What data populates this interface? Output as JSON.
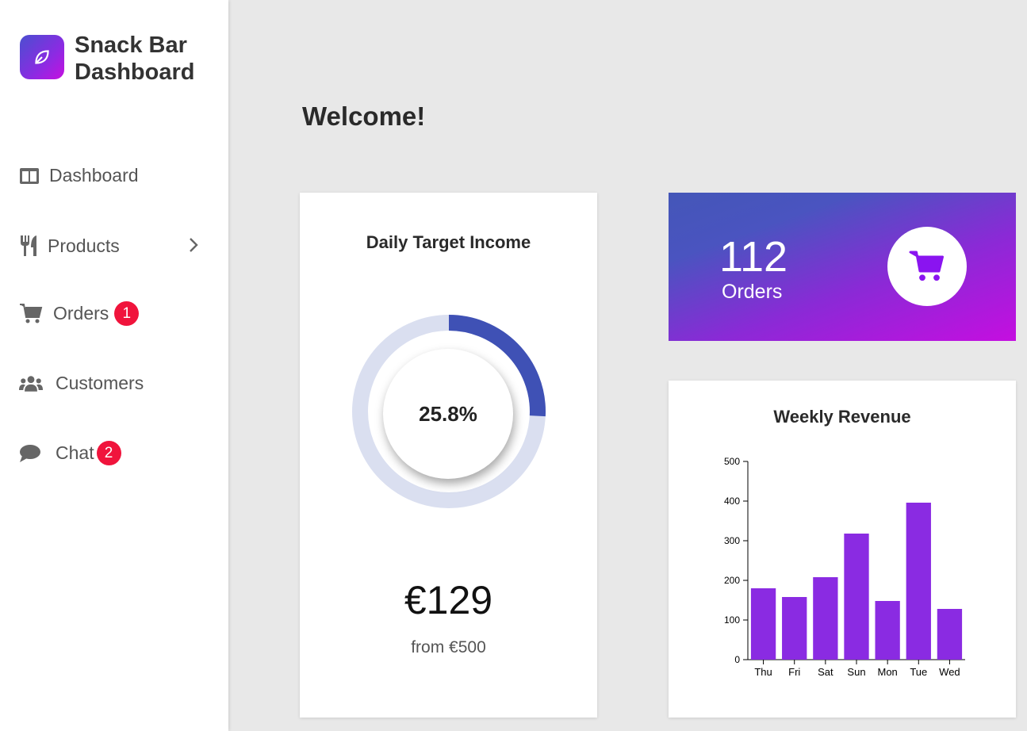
{
  "brand": {
    "line1": "Snack Bar",
    "line2": "Dashboard",
    "logo_icon": "leaf-icon"
  },
  "nav": {
    "dashboard": {
      "label": "Dashboard",
      "icon": "dashboard-icon"
    },
    "products": {
      "label": "Products",
      "icon": "utensils-icon"
    },
    "orders": {
      "label": "Orders",
      "icon": "cart-icon",
      "badge": "1"
    },
    "customers": {
      "label": "Customers",
      "icon": "users-icon"
    },
    "chat": {
      "label": "Chat",
      "icon": "chat-icon",
      "badge": "2"
    }
  },
  "main": {
    "welcome": "Welcome!"
  },
  "target": {
    "title": "Daily Target Income",
    "percent_label": "25.8%",
    "percent": 25.8,
    "amount": "€129",
    "from": "from €500"
  },
  "orders_card": {
    "count": "112",
    "label": "Orders",
    "icon": "cart-icon"
  },
  "colors": {
    "accent_blue": "#3f51b5",
    "track": "#dadff0",
    "bar": "#8a2be2",
    "badge": "#f0143c"
  },
  "chart_data": {
    "type": "bar",
    "title": "Weekly Revenue",
    "categories": [
      "Thu",
      "Fri",
      "Sat",
      "Sun",
      "Mon",
      "Tue",
      "Wed"
    ],
    "values": [
      180,
      158,
      208,
      318,
      148,
      396,
      128
    ],
    "ylim": [
      0,
      500
    ],
    "yticks": [
      "0",
      "100",
      "200",
      "300",
      "400",
      "500"
    ],
    "grid": false
  }
}
